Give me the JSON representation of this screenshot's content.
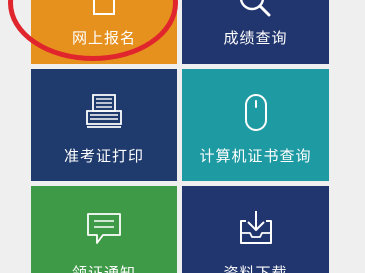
{
  "tiles": {
    "online_registration": {
      "label": "网上报名",
      "icon": "document-icon",
      "color": "#e6901e"
    },
    "score_query": {
      "label": "成绩查询",
      "icon": "magnifier-icon",
      "color": "#21366e"
    },
    "admission_ticket_print": {
      "label": "准考证打印",
      "icon": "printer-icon",
      "color": "#1f3a6d"
    },
    "computer_certificate_query": {
      "label": "计算机证书查询",
      "icon": "mouse-icon",
      "color": "#1e9aa3"
    },
    "receive_certificate_notice": {
      "label": "领证通知",
      "icon": "speech-bubble-icon",
      "color": "#3e9a47"
    },
    "material_download": {
      "label": "资料下载",
      "icon": "download-tray-icon",
      "color": "#21366e"
    }
  },
  "annotation": {
    "ring_color": "#e0252d"
  }
}
